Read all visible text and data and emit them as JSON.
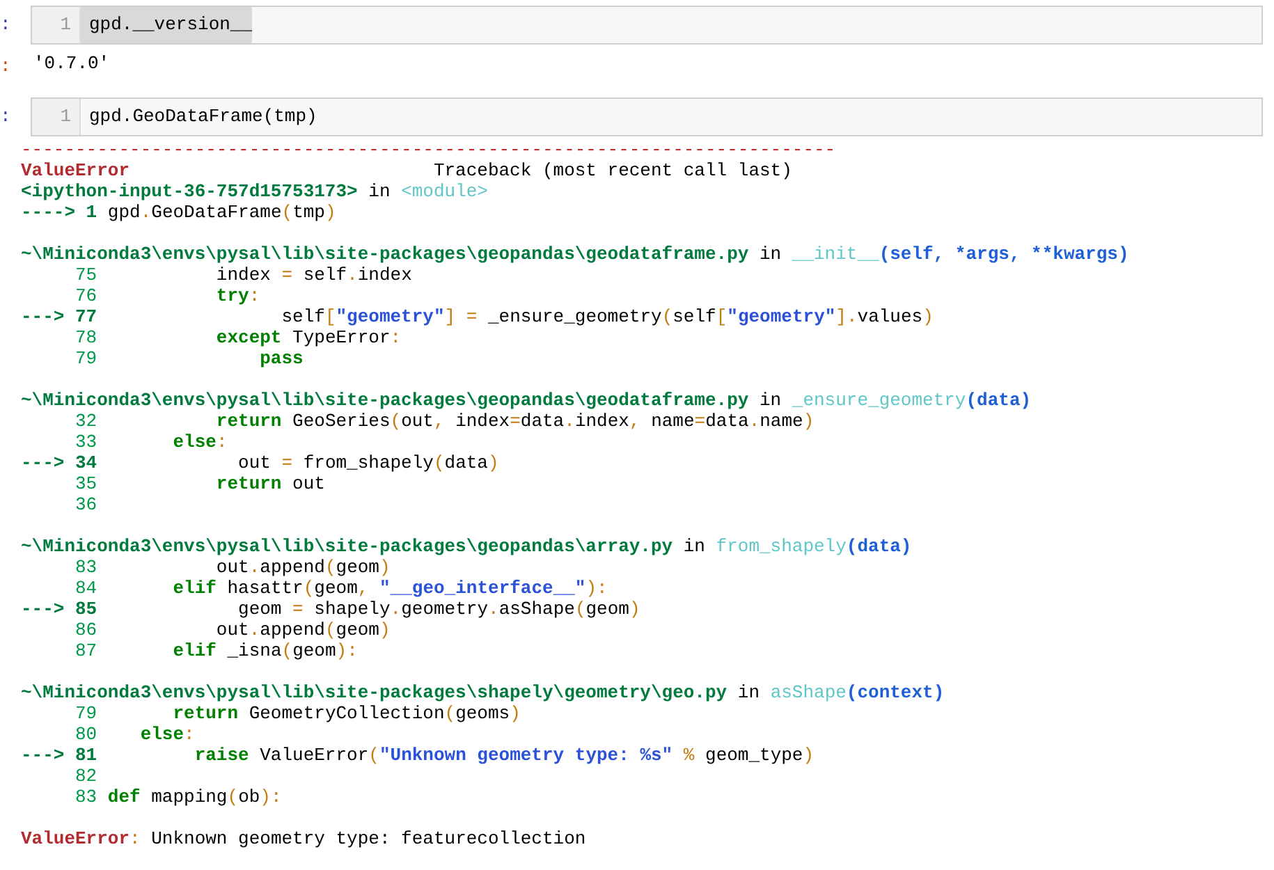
{
  "cells": [
    {
      "kind": "input",
      "prompt": ":",
      "line_number": "1",
      "code": "gpd.__version__",
      "highlighted": true
    },
    {
      "kind": "output",
      "prompt": ":",
      "text": "'0.7.0'"
    },
    {
      "kind": "input",
      "prompt": ":",
      "line_number": "1",
      "code": "gpd.GeoDataFrame(tmp)",
      "highlighted": false
    }
  ],
  "traceback": [
    {
      "lines": [
        [
          {
            "kind": "dash",
            "t": "---------------------------------------------------------------------------"
          }
        ],
        [
          {
            "kind": "err",
            "t": "ValueError"
          },
          {
            "kind": "pl",
            "t": "                            Traceback (most recent call last)"
          }
        ],
        [
          {
            "kind": "path",
            "t": "<ipython-input-36-757d15753173>"
          },
          {
            "kind": "pl",
            "t": " in "
          },
          {
            "kind": "fn",
            "t": "<module>"
          }
        ],
        [
          {
            "kind": "ar",
            "t": "----> 1 "
          },
          {
            "kind": "pl",
            "t": "gpd"
          },
          {
            "kind": "op",
            "t": "."
          },
          {
            "kind": "pl",
            "t": "GeoDataFrame"
          },
          {
            "kind": "op",
            "t": "("
          },
          {
            "kind": "pl",
            "t": "tmp"
          },
          {
            "kind": "op",
            "t": ")"
          }
        ]
      ]
    },
    {
      "lines": [
        [
          {
            "kind": "path",
            "t": "~\\Miniconda3\\envs\\pysal\\lib\\site-packages\\geopandas\\geodataframe.py"
          },
          {
            "kind": "pl",
            "t": " in "
          },
          {
            "kind": "fn",
            "t": "__init__"
          },
          {
            "kind": "args",
            "t": "(self, *args, **kwargs)"
          }
        ],
        [
          {
            "kind": "ln",
            "t": "     75"
          },
          {
            "kind": "pl",
            "t": "           index "
          },
          {
            "kind": "op",
            "t": "="
          },
          {
            "kind": "pl",
            "t": " self"
          },
          {
            "kind": "op",
            "t": "."
          },
          {
            "kind": "pl",
            "t": "index"
          }
        ],
        [
          {
            "kind": "ln",
            "t": "     76"
          },
          {
            "kind": "kw",
            "t": "           try"
          },
          {
            "kind": "op",
            "t": ":"
          }
        ],
        [
          {
            "kind": "ar",
            "t": "---> 77"
          },
          {
            "kind": "pl",
            "t": "                 self"
          },
          {
            "kind": "op",
            "t": "["
          },
          {
            "kind": "str",
            "t": "\"geometry\""
          },
          {
            "kind": "op",
            "t": "]"
          },
          {
            "kind": "op",
            "t": " ="
          },
          {
            "kind": "pl",
            "t": " _ensure_geometry"
          },
          {
            "kind": "op",
            "t": "("
          },
          {
            "kind": "pl",
            "t": "self"
          },
          {
            "kind": "op",
            "t": "["
          },
          {
            "kind": "str",
            "t": "\"geometry\""
          },
          {
            "kind": "op",
            "t": "]."
          },
          {
            "kind": "pl",
            "t": "values"
          },
          {
            "kind": "op",
            "t": ")"
          }
        ],
        [
          {
            "kind": "ln",
            "t": "     78"
          },
          {
            "kind": "kw",
            "t": "           except"
          },
          {
            "kind": "pl",
            "t": " TypeError"
          },
          {
            "kind": "op",
            "t": ":"
          }
        ],
        [
          {
            "kind": "ln",
            "t": "     79"
          },
          {
            "kind": "kw",
            "t": "               pass"
          }
        ]
      ]
    },
    {
      "lines": [
        [
          {
            "kind": "path",
            "t": "~\\Miniconda3\\envs\\pysal\\lib\\site-packages\\geopandas\\geodataframe.py"
          },
          {
            "kind": "pl",
            "t": " in "
          },
          {
            "kind": "fn",
            "t": "_ensure_geometry"
          },
          {
            "kind": "args",
            "t": "(data)"
          }
        ],
        [
          {
            "kind": "ln",
            "t": "     32"
          },
          {
            "kind": "kw",
            "t": "           return"
          },
          {
            "kind": "pl",
            "t": " GeoSeries"
          },
          {
            "kind": "op",
            "t": "("
          },
          {
            "kind": "pl",
            "t": "out"
          },
          {
            "kind": "op",
            "t": ","
          },
          {
            "kind": "pl",
            "t": " index"
          },
          {
            "kind": "op",
            "t": "="
          },
          {
            "kind": "pl",
            "t": "data"
          },
          {
            "kind": "op",
            "t": "."
          },
          {
            "kind": "pl",
            "t": "index"
          },
          {
            "kind": "op",
            "t": ","
          },
          {
            "kind": "pl",
            "t": " name"
          },
          {
            "kind": "op",
            "t": "="
          },
          {
            "kind": "pl",
            "t": "data"
          },
          {
            "kind": "op",
            "t": "."
          },
          {
            "kind": "pl",
            "t": "name"
          },
          {
            "kind": "op",
            "t": ")"
          }
        ],
        [
          {
            "kind": "ln",
            "t": "     33"
          },
          {
            "kind": "kw",
            "t": "       else"
          },
          {
            "kind": "op",
            "t": ":"
          }
        ],
        [
          {
            "kind": "ar",
            "t": "---> 34"
          },
          {
            "kind": "pl",
            "t": "             out "
          },
          {
            "kind": "op",
            "t": "="
          },
          {
            "kind": "pl",
            "t": " from_shapely"
          },
          {
            "kind": "op",
            "t": "("
          },
          {
            "kind": "pl",
            "t": "data"
          },
          {
            "kind": "op",
            "t": ")"
          }
        ],
        [
          {
            "kind": "ln",
            "t": "     35"
          },
          {
            "kind": "kw",
            "t": "           return"
          },
          {
            "kind": "pl",
            "t": " out"
          }
        ],
        [
          {
            "kind": "ln",
            "t": "     36"
          }
        ]
      ]
    },
    {
      "lines": [
        [
          {
            "kind": "path",
            "t": "~\\Miniconda3\\envs\\pysal\\lib\\site-packages\\geopandas\\array.py"
          },
          {
            "kind": "pl",
            "t": " in "
          },
          {
            "kind": "fn",
            "t": "from_shapely"
          },
          {
            "kind": "args",
            "t": "(data)"
          }
        ],
        [
          {
            "kind": "ln",
            "t": "     83"
          },
          {
            "kind": "pl",
            "t": "           out"
          },
          {
            "kind": "op",
            "t": "."
          },
          {
            "kind": "pl",
            "t": "append"
          },
          {
            "kind": "op",
            "t": "("
          },
          {
            "kind": "pl",
            "t": "geom"
          },
          {
            "kind": "op",
            "t": ")"
          }
        ],
        [
          {
            "kind": "ln",
            "t": "     84"
          },
          {
            "kind": "kw",
            "t": "       elif"
          },
          {
            "kind": "pl",
            "t": " hasattr"
          },
          {
            "kind": "op",
            "t": "("
          },
          {
            "kind": "pl",
            "t": "geom"
          },
          {
            "kind": "op",
            "t": ", "
          },
          {
            "kind": "str",
            "t": "\"__geo_interface__\""
          },
          {
            "kind": "op",
            "t": "):"
          }
        ],
        [
          {
            "kind": "ar",
            "t": "---> 85"
          },
          {
            "kind": "pl",
            "t": "             geom "
          },
          {
            "kind": "op",
            "t": "="
          },
          {
            "kind": "pl",
            "t": " shapely"
          },
          {
            "kind": "op",
            "t": "."
          },
          {
            "kind": "pl",
            "t": "geometry"
          },
          {
            "kind": "op",
            "t": "."
          },
          {
            "kind": "pl",
            "t": "asShape"
          },
          {
            "kind": "op",
            "t": "("
          },
          {
            "kind": "pl",
            "t": "geom"
          },
          {
            "kind": "op",
            "t": ")"
          }
        ],
        [
          {
            "kind": "ln",
            "t": "     86"
          },
          {
            "kind": "pl",
            "t": "           out"
          },
          {
            "kind": "op",
            "t": "."
          },
          {
            "kind": "pl",
            "t": "append"
          },
          {
            "kind": "op",
            "t": "("
          },
          {
            "kind": "pl",
            "t": "geom"
          },
          {
            "kind": "op",
            "t": ")"
          }
        ],
        [
          {
            "kind": "ln",
            "t": "     87"
          },
          {
            "kind": "kw",
            "t": "       elif"
          },
          {
            "kind": "pl",
            "t": " _isna"
          },
          {
            "kind": "op",
            "t": "("
          },
          {
            "kind": "pl",
            "t": "geom"
          },
          {
            "kind": "op",
            "t": "):"
          }
        ]
      ]
    },
    {
      "lines": [
        [
          {
            "kind": "path",
            "t": "~\\Miniconda3\\envs\\pysal\\lib\\site-packages\\shapely\\geometry\\geo.py"
          },
          {
            "kind": "pl",
            "t": " in "
          },
          {
            "kind": "fn",
            "t": "asShape"
          },
          {
            "kind": "args",
            "t": "(context)"
          }
        ],
        [
          {
            "kind": "ln",
            "t": "     79"
          },
          {
            "kind": "kw",
            "t": "       return"
          },
          {
            "kind": "pl",
            "t": " GeometryCollection"
          },
          {
            "kind": "op",
            "t": "("
          },
          {
            "kind": "pl",
            "t": "geoms"
          },
          {
            "kind": "op",
            "t": ")"
          }
        ],
        [
          {
            "kind": "ln",
            "t": "     80"
          },
          {
            "kind": "kw",
            "t": "    else"
          },
          {
            "kind": "op",
            "t": ":"
          }
        ],
        [
          {
            "kind": "ar",
            "t": "---> 81"
          },
          {
            "kind": "kw",
            "t": "         raise"
          },
          {
            "kind": "pl",
            "t": " ValueError"
          },
          {
            "kind": "op",
            "t": "("
          },
          {
            "kind": "str",
            "t": "\"Unknown geometry type: %s\""
          },
          {
            "kind": "op",
            "t": " %"
          },
          {
            "kind": "pl",
            "t": " geom_type"
          },
          {
            "kind": "op",
            "t": ")"
          }
        ],
        [
          {
            "kind": "ln",
            "t": "     82"
          }
        ],
        [
          {
            "kind": "ln",
            "t": "     83"
          },
          {
            "kind": "kw",
            "t": " def"
          },
          {
            "kind": "pl",
            "t": " mapping"
          },
          {
            "kind": "op",
            "t": "("
          },
          {
            "kind": "pl",
            "t": "ob"
          },
          {
            "kind": "op",
            "t": "):"
          }
        ]
      ]
    },
    {
      "lines": [
        [
          {
            "kind": "err",
            "t": "ValueError"
          },
          {
            "kind": "op",
            "t": ":"
          },
          {
            "kind": "pl",
            "t": " Unknown geometry type: featurecollection"
          }
        ]
      ]
    }
  ]
}
